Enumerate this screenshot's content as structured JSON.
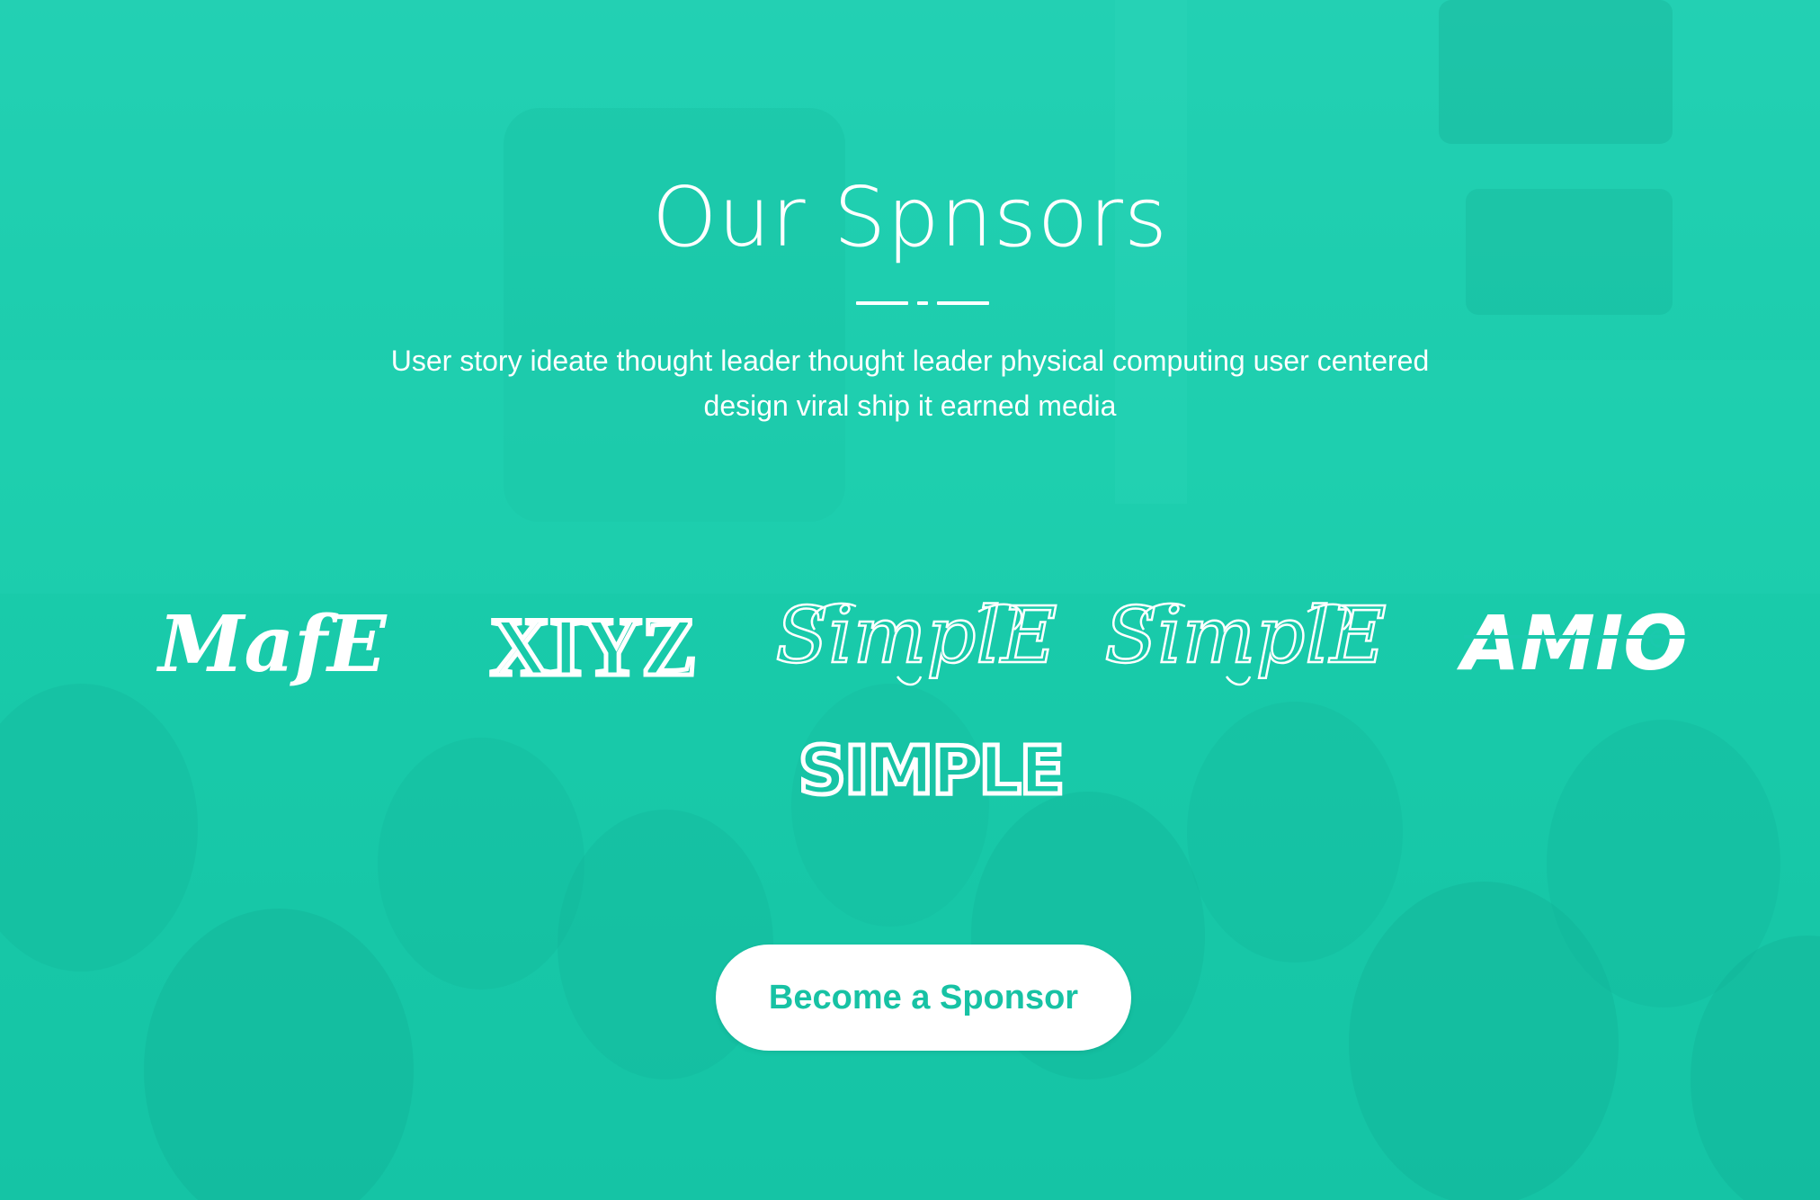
{
  "section": {
    "title": "Our Spnsors",
    "description": "User story ideate thought leader thought leader physical computing user centered design viral ship it earned media"
  },
  "sponsors": [
    {
      "name": "MafE",
      "icon": "blackletter-logo"
    },
    {
      "name": "XIYZ",
      "icon": "outline-serif-logo"
    },
    {
      "name": "SimplE",
      "icon": "script-logo"
    },
    {
      "name": "SimplE",
      "icon": "script-logo"
    },
    {
      "name": "AMIO",
      "icon": "stencil-logo"
    },
    {
      "name": "SIMPLE",
      "icon": "geometric-logo"
    }
  ],
  "cta": {
    "label": "Become a Sponsor"
  },
  "colors": {
    "accent": "#1bc9ad",
    "button_text": "#17c2a4",
    "text": "#ffffff"
  }
}
